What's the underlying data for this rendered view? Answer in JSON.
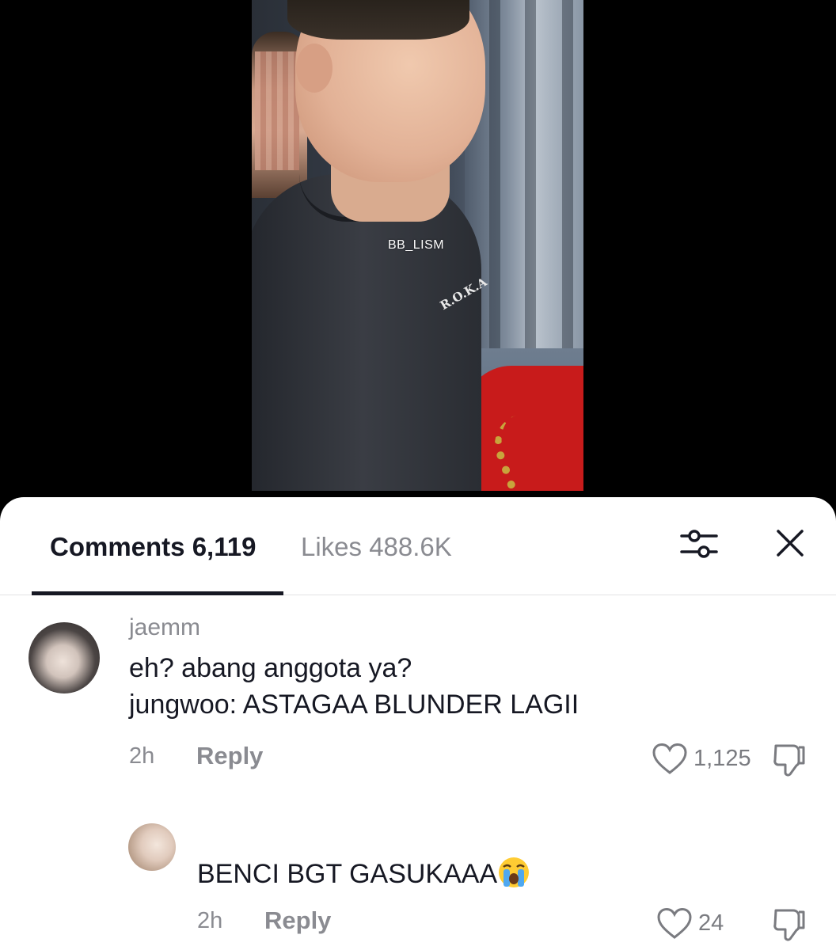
{
  "video": {
    "watermark": "BB_LISM",
    "shirt_print": "R.O.K.A"
  },
  "tabs": {
    "comments_label": "Comments 6,119",
    "likes_label": "Likes 488.6K"
  },
  "icons": {
    "filter": "filter-sliders-icon",
    "close": "close-icon",
    "like": "heart-outline-icon",
    "dislike": "thumbs-down-icon"
  },
  "comments": [
    {
      "username": "jaemm",
      "text_line1": "eh? abang anggota ya?",
      "text_line2": "jungwoo: ASTAGAA BLUNDER LAGII",
      "time": "2h",
      "reply_label": "Reply",
      "likes": "1,125"
    },
    {
      "username": "",
      "text": "BENCI BGT GASUKAAA",
      "emoji": "loudly-crying-face",
      "time": "2h",
      "reply_label": "Reply",
      "likes": "24"
    }
  ],
  "colors": {
    "text_primary": "#161823",
    "text_secondary": "#8a8b91",
    "divider": "#e3e3e4"
  }
}
